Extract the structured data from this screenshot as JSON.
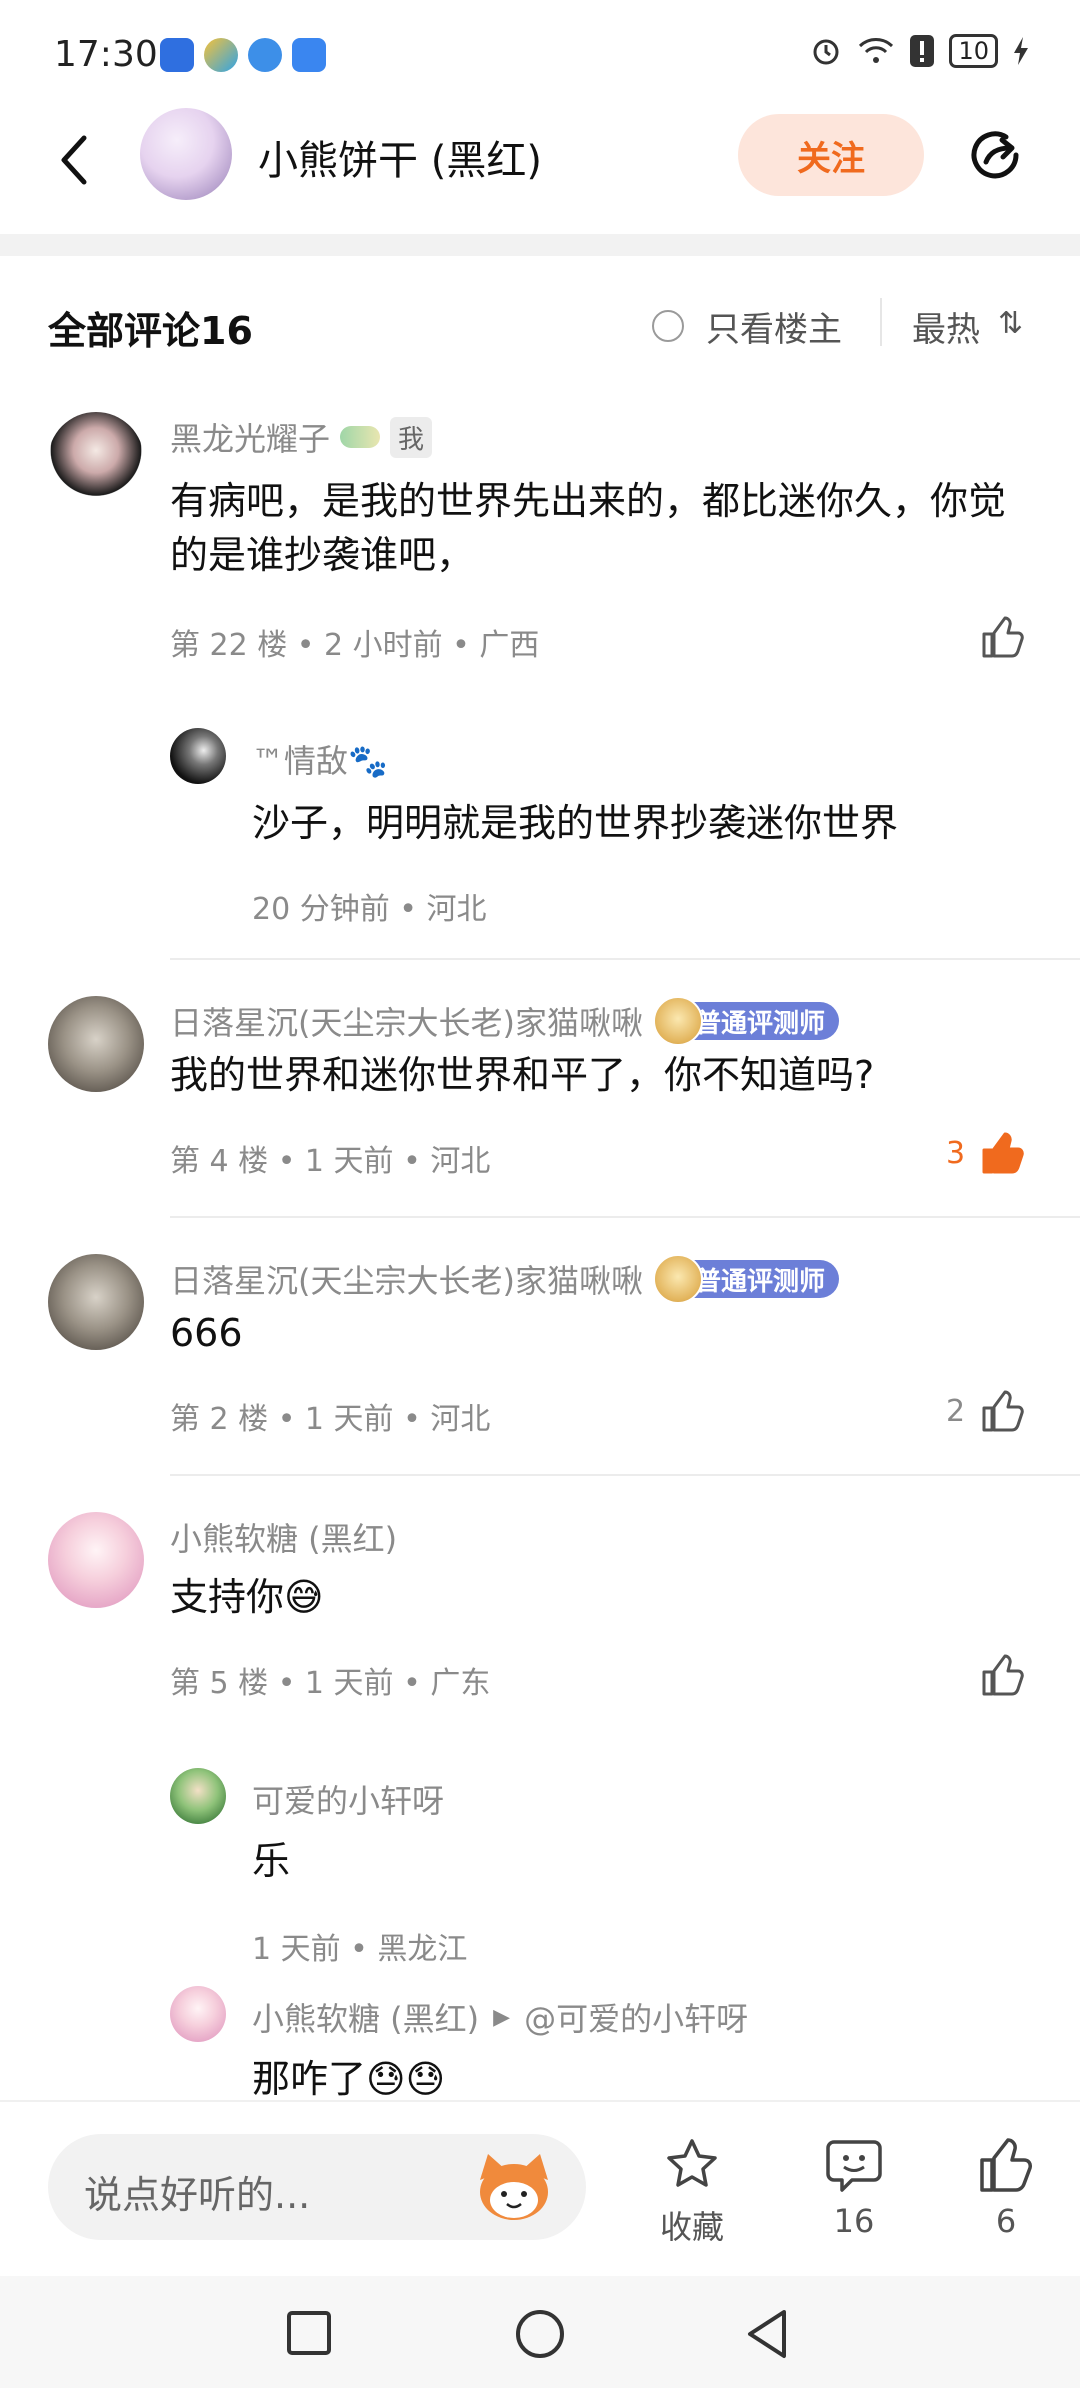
{
  "status_bar": {
    "time": "17:30",
    "battery": "10",
    "icons": [
      "baidu-app-icon",
      "yellow-app-icon",
      "blue-app-icon",
      "store-app-icon",
      "alarm-icon",
      "wifi-icon",
      "alert-icon",
      "battery-icon",
      "charging-icon"
    ]
  },
  "header": {
    "title": "小熊饼干 (黑红)",
    "follow_label": "关注",
    "icons": [
      "back-icon",
      "share-icon"
    ]
  },
  "comments_header": {
    "title": "全部评论16",
    "only_host_label": "只看楼主",
    "sort_label": "最热",
    "sort_icon": "⇅"
  },
  "comments": [
    {
      "name": "黑龙光耀子",
      "me_badge": "我",
      "text": "有病吧，是我的世界先出来的，都比迷你久，你觉的是谁抄袭谁吧，",
      "meta": "第 22 楼 • 2 小时前 • 广西",
      "likes": ""
    },
    {
      "reply": true,
      "name": "™情敌🐾",
      "text": "沙子，明明就是我的世界抄袭迷你世界",
      "meta": "20 分钟前 • 河北"
    },
    {
      "name": "日落星沉(天尘宗大长老)家猫啾啾",
      "badge": "普通评测师",
      "text": "我的世界和迷你世界和平了，你不知道吗?",
      "meta": "第 4 楼 • 1 天前 • 河北",
      "likes": "3"
    },
    {
      "name": "日落星沉(天尘宗大长老)家猫啾啾",
      "badge": "普通评测师",
      "text": "666",
      "meta": "第 2 楼 • 1 天前 • 河北",
      "likes": "2"
    },
    {
      "name": "小熊软糖 (黑红)",
      "text": "支持你😅",
      "meta": "第 5 楼 • 1 天前 • 广东",
      "likes": ""
    },
    {
      "reply": true,
      "name": "可爱的小轩呀",
      "text": "乐",
      "meta": "1 天前 • 黑龙江"
    },
    {
      "reply": true,
      "name": "小熊软糖 (黑红)",
      "reply_to": "@可爱的小轩呀",
      "text": "那咋了😓😓"
    }
  ],
  "bottom_bar": {
    "input_placeholder": "说点好听的...",
    "favorite_label": "收藏",
    "comment_count": "16",
    "like_count": "6"
  },
  "colors": {
    "accent": "#f06a1e",
    "follow_bg": "#fde5db",
    "liked": "#f06a1e",
    "badge": "#6c7fd8"
  }
}
